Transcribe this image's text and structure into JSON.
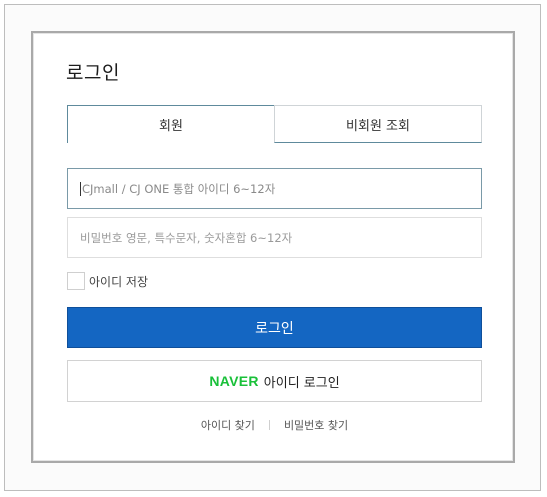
{
  "page": {
    "title": "로그인"
  },
  "tabs": [
    {
      "label": "회원",
      "active": true
    },
    {
      "label": "비회원 조회",
      "active": false
    }
  ],
  "form": {
    "id_placeholder": "CJmall / CJ ONE 통합 아이디 6~12자",
    "password_placeholder": "비밀번호 영문, 특수문자, 숫자혼합 6~12자",
    "save_id_label": "아이디 저장",
    "save_id_checked": false,
    "login_button": "로그인"
  },
  "naver": {
    "logo_text": "NAVER",
    "label": "아이디 로그인"
  },
  "links": {
    "find_id": "아이디 찾기",
    "find_password": "비밀번호 찾기"
  },
  "colors": {
    "primary": "#1466c2",
    "naver_green": "#19c039",
    "tab_border": "#5e8a9c"
  }
}
